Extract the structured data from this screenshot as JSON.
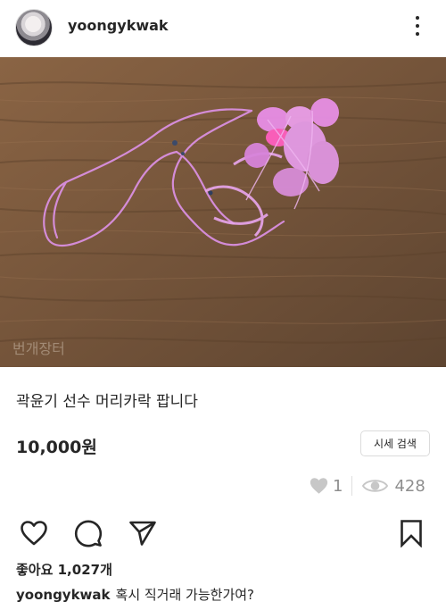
{
  "post": {
    "username": "yoongykwak",
    "photo_watermark": "번개장터",
    "title": "곽윤기 선수 머리카락 팝니다",
    "price": "10,000원",
    "price_check_button": "시세 검색",
    "like_count": "1",
    "view_count": "428",
    "likes_label": "좋아요 1,027개",
    "caption_username": "yoongykwak",
    "caption_text": "혹시 직거래 가능한가여?"
  },
  "icons": {
    "more": "more-vertical-icon",
    "like_stat": "heart-icon",
    "views": "eye-icon",
    "like": "heart-outline-icon",
    "comment": "comment-icon",
    "share": "send-icon",
    "save": "bookmark-icon"
  },
  "colors": {
    "text": "#262626",
    "muted": "#8e8e8e",
    "stat_icon": "#c7c7c7"
  }
}
